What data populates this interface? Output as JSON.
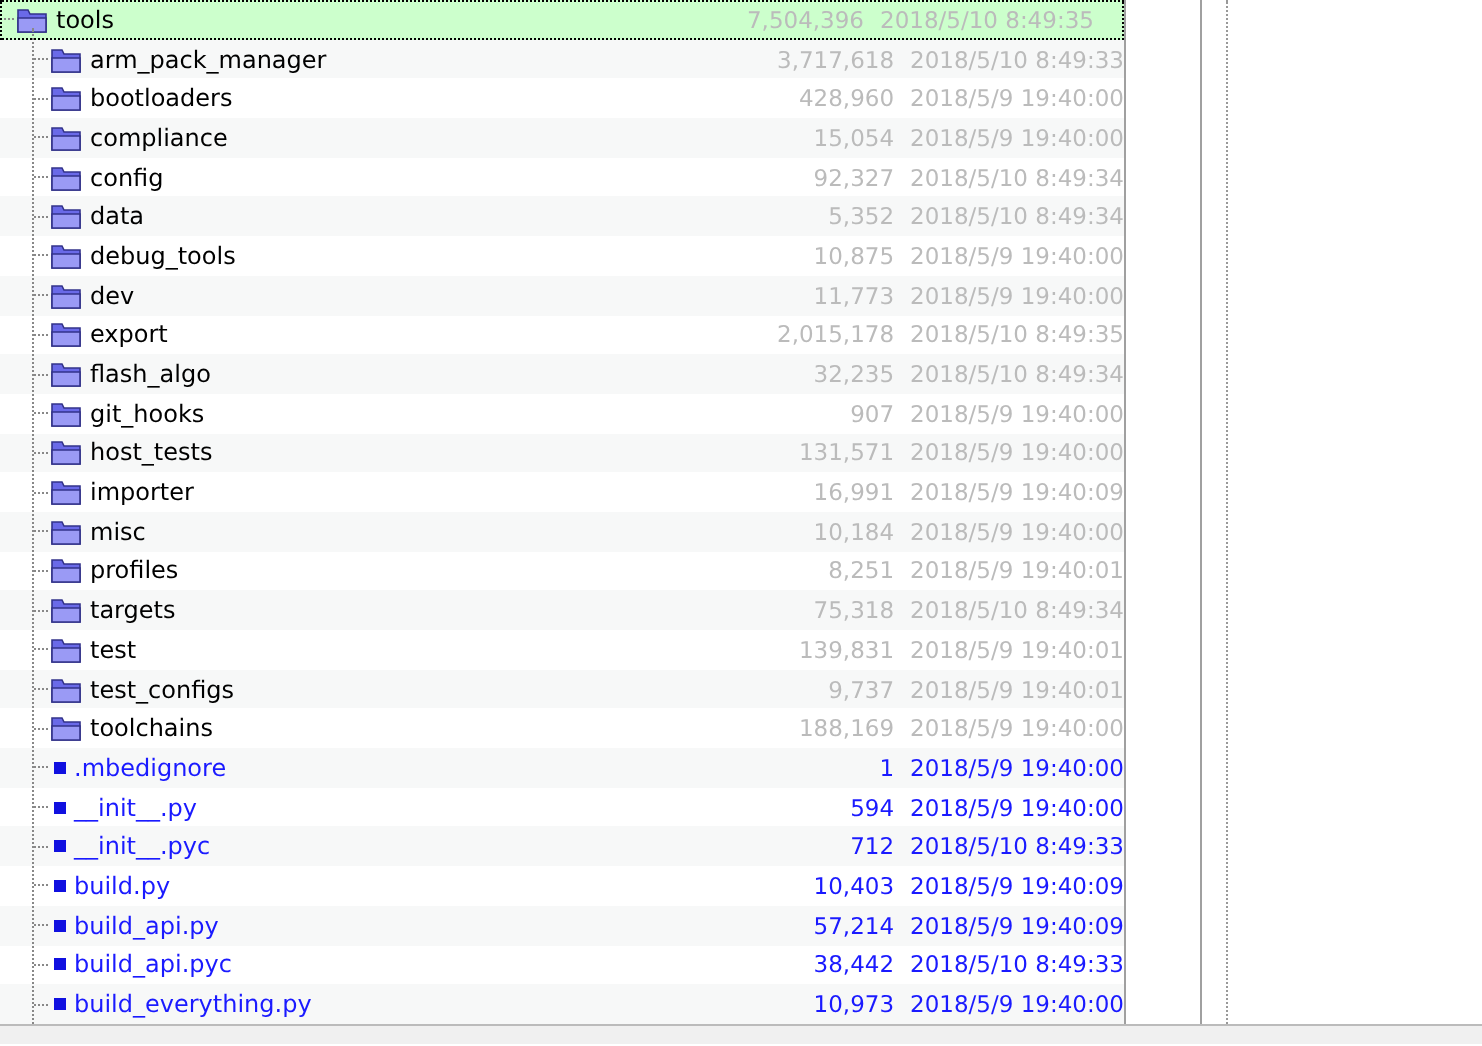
{
  "tree": {
    "name": "tools",
    "size": "7,504,396",
    "modified": "2018/5/10 8:49:35",
    "selected": true,
    "kind": "folder",
    "children": [
      {
        "name": "arm_pack_manager",
        "size": "3,717,618",
        "modified": "2018/5/10 8:49:33",
        "kind": "folder",
        "selected": false
      },
      {
        "name": "bootloaders",
        "size": "428,960",
        "modified": "2018/5/9 19:40:00",
        "kind": "folder",
        "selected": false
      },
      {
        "name": "compliance",
        "size": "15,054",
        "modified": "2018/5/9 19:40:00",
        "kind": "folder",
        "selected": false
      },
      {
        "name": "config",
        "size": "92,327",
        "modified": "2018/5/10 8:49:34",
        "kind": "folder",
        "selected": false
      },
      {
        "name": "data",
        "size": "5,352",
        "modified": "2018/5/10 8:49:34",
        "kind": "folder",
        "selected": false
      },
      {
        "name": "debug_tools",
        "size": "10,875",
        "modified": "2018/5/9 19:40:00",
        "kind": "folder",
        "selected": false
      },
      {
        "name": "dev",
        "size": "11,773",
        "modified": "2018/5/9 19:40:00",
        "kind": "folder",
        "selected": false
      },
      {
        "name": "export",
        "size": "2,015,178",
        "modified": "2018/5/10 8:49:35",
        "kind": "folder",
        "selected": false
      },
      {
        "name": "flash_algo",
        "size": "32,235",
        "modified": "2018/5/10 8:49:34",
        "kind": "folder",
        "selected": false
      },
      {
        "name": "git_hooks",
        "size": "907",
        "modified": "2018/5/9 19:40:00",
        "kind": "folder",
        "selected": false
      },
      {
        "name": "host_tests",
        "size": "131,571",
        "modified": "2018/5/9 19:40:00",
        "kind": "folder",
        "selected": false
      },
      {
        "name": "importer",
        "size": "16,991",
        "modified": "2018/5/9 19:40:09",
        "kind": "folder",
        "selected": false
      },
      {
        "name": "misc",
        "size": "10,184",
        "modified": "2018/5/9 19:40:00",
        "kind": "folder",
        "selected": false
      },
      {
        "name": "profiles",
        "size": "8,251",
        "modified": "2018/5/9 19:40:01",
        "kind": "folder",
        "selected": false
      },
      {
        "name": "targets",
        "size": "75,318",
        "modified": "2018/5/10 8:49:34",
        "kind": "folder",
        "selected": false
      },
      {
        "name": "test",
        "size": "139,831",
        "modified": "2018/5/9 19:40:01",
        "kind": "folder",
        "selected": false
      },
      {
        "name": "test_configs",
        "size": "9,737",
        "modified": "2018/5/9 19:40:01",
        "kind": "folder",
        "selected": false
      },
      {
        "name": "toolchains",
        "size": "188,169",
        "modified": "2018/5/9 19:40:00",
        "kind": "folder",
        "selected": false
      },
      {
        "name": ".mbedignore",
        "size": "1",
        "modified": "2018/5/9 19:40:00",
        "kind": "file",
        "selected": false
      },
      {
        "name": "__init__.py",
        "size": "594",
        "modified": "2018/5/9 19:40:00",
        "kind": "file",
        "selected": false
      },
      {
        "name": "__init__.pyc",
        "size": "712",
        "modified": "2018/5/10 8:49:33",
        "kind": "file",
        "selected": false
      },
      {
        "name": "build.py",
        "size": "10,403",
        "modified": "2018/5/9 19:40:09",
        "kind": "file",
        "selected": false
      },
      {
        "name": "build_api.py",
        "size": "57,214",
        "modified": "2018/5/9 19:40:09",
        "kind": "file",
        "selected": false
      },
      {
        "name": "build_api.pyc",
        "size": "38,442",
        "modified": "2018/5/10 8:49:33",
        "kind": "file",
        "selected": false
      },
      {
        "name": "build_everything.py",
        "size": "10,973",
        "modified": "2018/5/9 19:40:00",
        "kind": "file",
        "selected": false
      }
    ]
  }
}
